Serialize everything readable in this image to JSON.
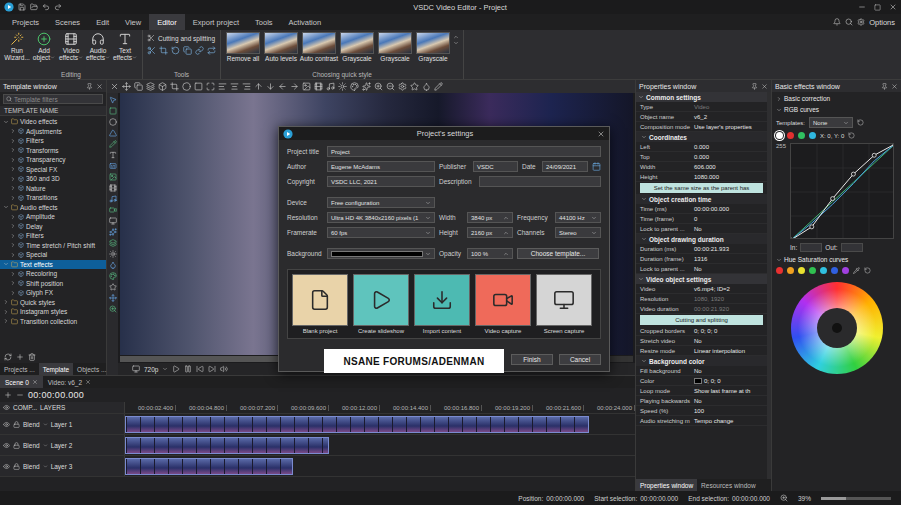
{
  "window": {
    "title": "VSDC Video Editor - Project"
  },
  "menu": {
    "tabs": [
      {
        "label": "Projects",
        "selected": false
      },
      {
        "label": "Scenes",
        "selected": false
      },
      {
        "label": "Edit",
        "selected": false
      },
      {
        "label": "View",
        "selected": false
      },
      {
        "label": "Editor",
        "selected": true
      },
      {
        "label": "Export project",
        "selected": false
      },
      {
        "label": "Tools",
        "selected": false
      },
      {
        "label": "Activation",
        "selected": false
      }
    ],
    "options": "Options"
  },
  "ribbon": {
    "editing": {
      "label": "Editing",
      "buttons": [
        {
          "label": "Run Wizard...",
          "dropdown": false
        },
        {
          "label": "Add object",
          "dropdown": true
        },
        {
          "label": "Video effects",
          "dropdown": true
        },
        {
          "label": "Audio effects",
          "dropdown": true
        },
        {
          "label": "Text effects",
          "dropdown": true
        }
      ]
    },
    "tools": {
      "label": "Tools",
      "button": "Cutting and splitting"
    },
    "quick_style": {
      "label": "Choosing quick style",
      "items": [
        {
          "label": "Remove all"
        },
        {
          "label": "Auto levels"
        },
        {
          "label": "Auto contrast"
        },
        {
          "label": "Grayscale"
        },
        {
          "label": "Grayscale"
        },
        {
          "label": "Grayscale"
        }
      ]
    }
  },
  "template_window": {
    "title": "Template window",
    "search": {
      "placeholder": "Template filters"
    },
    "column": "TEMPLATE NAME",
    "items": [
      {
        "label": "Video effects",
        "depth": 0,
        "expanded": true,
        "selected": false
      },
      {
        "label": "Adjustments",
        "depth": 1,
        "expanded": false,
        "selected": false
      },
      {
        "label": "Filters",
        "depth": 1,
        "expanded": false,
        "selected": false
      },
      {
        "label": "Transforms",
        "depth": 1,
        "expanded": false,
        "selected": false
      },
      {
        "label": "Transparency",
        "depth": 1,
        "expanded": false,
        "selected": false
      },
      {
        "label": "Special FX",
        "depth": 1,
        "expanded": false,
        "selected": false
      },
      {
        "label": "360 and 3D",
        "depth": 1,
        "expanded": false,
        "selected": false
      },
      {
        "label": "Nature",
        "depth": 1,
        "expanded": false,
        "selected": false
      },
      {
        "label": "Transitions",
        "depth": 1,
        "expanded": false,
        "selected": false
      },
      {
        "label": "Audio effects",
        "depth": 0,
        "expanded": true,
        "selected": false
      },
      {
        "label": "Amplitude",
        "depth": 1,
        "expanded": false,
        "selected": false
      },
      {
        "label": "Delay",
        "depth": 1,
        "expanded": false,
        "selected": false
      },
      {
        "label": "Filters",
        "depth": 1,
        "expanded": false,
        "selected": false
      },
      {
        "label": "Time stretch / Pitch shift",
        "depth": 1,
        "expanded": false,
        "selected": false
      },
      {
        "label": "Special",
        "depth": 1,
        "expanded": false,
        "selected": false
      },
      {
        "label": "Text effects",
        "depth": 0,
        "expanded": true,
        "selected": true
      },
      {
        "label": "Recoloring",
        "depth": 1,
        "expanded": false,
        "selected": false
      },
      {
        "label": "Shift position",
        "depth": 1,
        "expanded": false,
        "selected": false
      },
      {
        "label": "Glyph FX",
        "depth": 1,
        "expanded": false,
        "selected": false
      },
      {
        "label": "Quick styles",
        "depth": 0,
        "expanded": false,
        "selected": false
      },
      {
        "label": "Instagram styles",
        "depth": 0,
        "expanded": false,
        "selected": false
      },
      {
        "label": "Transition collection",
        "depth": 0,
        "expanded": false,
        "selected": false
      }
    ],
    "tabs": [
      {
        "label": "Projects ...",
        "selected": false
      },
      {
        "label": "Template",
        "selected": true
      },
      {
        "label": "Objects ...",
        "selected": false
      }
    ]
  },
  "preview": {
    "quality": "720p"
  },
  "dialog": {
    "title": "Project's settings",
    "project_title": {
      "label": "Project title",
      "value": "Project"
    },
    "author": {
      "label": "Author",
      "value": "Eugene McAdams"
    },
    "publisher": {
      "label": "Publisher",
      "value": "VSDC"
    },
    "date": {
      "label": "Date",
      "value": "24/09/2021"
    },
    "copyright": {
      "label": "Copyright",
      "value": "VSDC LLC, 2021"
    },
    "description": {
      "label": "Description",
      "value": ""
    },
    "device": {
      "label": "Device",
      "value": "Free configuration"
    },
    "resolution": {
      "label": "Resolution",
      "value": "Ultra HD 4K 3840x2160 pixels (1"
    },
    "width": {
      "label": "Width",
      "value": "3840 px"
    },
    "frequency": {
      "label": "Frequency",
      "value": "44100 Hz"
    },
    "framerate": {
      "label": "Framerate",
      "value": "60 fps"
    },
    "height": {
      "label": "Height",
      "value": "2160 px"
    },
    "channels": {
      "label": "Channels",
      "value": "Stereo"
    },
    "background": {
      "label": "Background",
      "swatch": "#000000"
    },
    "opacity": {
      "label": "Opacity",
      "value": "100 %"
    },
    "choose_template": "Choose template...",
    "templates": [
      {
        "label": "Blank project",
        "color": "#e9d3a9"
      },
      {
        "label": "Create slideshow",
        "color": "#5fc4bd"
      },
      {
        "label": "Import content",
        "color": "#4dbab2"
      },
      {
        "label": "Video capture",
        "color": "#ef6a5a"
      },
      {
        "label": "Screen capture",
        "color": "#d5d5d5"
      }
    ],
    "buttons": [
      "Finish",
      "Cancel"
    ]
  },
  "watermark": "NSANE FORUMS/ADENMAN",
  "timeline": {
    "tabs": [
      {
        "label": "Scene 0",
        "selected": true
      },
      {
        "label": "Video: v6_2",
        "selected": false
      }
    ],
    "time": "00:00:00.000",
    "comp": "COMP...",
    "layers_label": "LAYERS",
    "ticks": [
      "00:00:02.400",
      "00:00:04.800",
      "00:00:07.200",
      "00:00:09.600",
      "00:00:12.000",
      "00:00:14.400",
      "00:00:16.800",
      "00:00:19.200",
      "00:00:21.600",
      "00:00:24.000"
    ],
    "layers": [
      {
        "blend": "Blend",
        "name": "Layer 1",
        "level": 0.91
      },
      {
        "blend": "Blend",
        "name": "Layer 2",
        "level": 0.4
      },
      {
        "blend": "Blend",
        "name": "Layer 3",
        "level": 0.33
      }
    ]
  },
  "properties": {
    "title": "Properties window",
    "rows": [
      {
        "kind": "section",
        "label": "Common settings"
      },
      {
        "kind": "field",
        "label": "Type",
        "value": "Video",
        "disabled": true
      },
      {
        "kind": "field",
        "label": "Object name",
        "value": "v6_2",
        "disabled": false
      },
      {
        "kind": "field",
        "label": "Composition mode",
        "value": "Use layer's properties",
        "disabled": false
      },
      {
        "kind": "subsection",
        "label": "Coordinates"
      },
      {
        "kind": "field",
        "label": "Left",
        "value": "0.000",
        "disabled": false
      },
      {
        "kind": "field",
        "label": "Top",
        "value": "0.000",
        "disabled": false
      },
      {
        "kind": "field",
        "label": "Width",
        "value": "606.000",
        "disabled": false
      },
      {
        "kind": "field",
        "label": "Height",
        "value": "1080.000",
        "disabled": false
      },
      {
        "kind": "button",
        "label": "Set the same size as the parent has"
      },
      {
        "kind": "subsection",
        "label": "Object creation time"
      },
      {
        "kind": "field",
        "label": "Time (ms)",
        "value": "00:00:00.000",
        "disabled": false
      },
      {
        "kind": "field",
        "label": "Time (frame)",
        "value": "0",
        "disabled": false
      },
      {
        "kind": "field",
        "label": "Lock to parent ...",
        "value": "No",
        "disabled": false
      },
      {
        "kind": "subsection",
        "label": "Object drawing duration"
      },
      {
        "kind": "field",
        "label": "Duration (ms)",
        "value": "00:00:21.933",
        "disabled": false
      },
      {
        "kind": "field",
        "label": "Duration (frame)",
        "value": "1316",
        "disabled": false
      },
      {
        "kind": "field",
        "label": "Lock to parent ...",
        "value": "No",
        "disabled": false
      },
      {
        "kind": "section",
        "label": "Video object settings"
      },
      {
        "kind": "field",
        "label": "Video",
        "value": "v6.mp4; ID=2",
        "disabled": false
      },
      {
        "kind": "field",
        "label": "Resolution",
        "value": "1080, 1920",
        "disabled": true
      },
      {
        "kind": "field",
        "label": "Video duration",
        "value": "00:00:21.920",
        "disabled": true
      },
      {
        "kind": "button",
        "label": "Cutting and splitting"
      },
      {
        "kind": "field",
        "label": "Cropped borders",
        "value": "0; 0; 0; 0",
        "disabled": false
      },
      {
        "kind": "field",
        "label": "Stretch video",
        "value": "No",
        "disabled": false
      },
      {
        "kind": "field",
        "label": "Resize mode",
        "value": "Linear interpolation",
        "disabled": false
      },
      {
        "kind": "subsection",
        "label": "Background color"
      },
      {
        "kind": "field",
        "label": "Fill background",
        "value": "No",
        "disabled": false
      },
      {
        "kind": "field",
        "label": "Color",
        "value": "0; 0; 0",
        "swatch": "#000000",
        "disabled": false
      },
      {
        "kind": "field",
        "label": "Loop mode",
        "value": "Show last frame at th",
        "disabled": false
      },
      {
        "kind": "field",
        "label": "Playing backwards",
        "value": "No",
        "disabled": false
      },
      {
        "kind": "field",
        "label": "Speed (%)",
        "value": "100",
        "disabled": false
      },
      {
        "kind": "field",
        "label": "Audio stretching m",
        "value": "Tempo change",
        "disabled": false
      }
    ],
    "tabs": [
      {
        "label": "Properties window",
        "selected": true
      },
      {
        "label": "Resources window",
        "selected": false
      }
    ]
  },
  "effects": {
    "title": "Basic effects window",
    "section": "Basic correction",
    "rgb": {
      "title": "RGB curves",
      "templates_label": "Templates:",
      "template": "None",
      "channels": [
        {
          "color": "#ffffff",
          "selected": true
        },
        {
          "color": "#e03030",
          "selected": false
        },
        {
          "color": "#30c060",
          "selected": false
        },
        {
          "color": "#30b8e0",
          "selected": false
        }
      ],
      "coords": "X: 0, Y: 0",
      "axis_max": "255",
      "in_label": "In:",
      "out_label": "Out:",
      "series": [
        {
          "name": "Green",
          "color": "#3cb371",
          "markers": false,
          "values": [
            0,
            51,
            102,
            153,
            204,
            255
          ]
        },
        {
          "name": "Blue",
          "color": "#4aa3df",
          "markers": false,
          "values": [
            0,
            45,
            95,
            150,
            210,
            255
          ]
        },
        {
          "name": "Master",
          "color": "#e8e8e8",
          "markers": true,
          "values": [
            0,
            35,
            110,
            175,
            225,
            255
          ]
        }
      ]
    },
    "hue": {
      "title": "Hue Saturation curves",
      "colors": [
        {
          "color": "#e83030"
        },
        {
          "color": "#f0a020"
        },
        {
          "color": "#e8e030"
        },
        {
          "color": "#30c050"
        },
        {
          "color": "#30c0e0"
        },
        {
          "color": "#3060e0"
        },
        {
          "color": "#a040e0"
        }
      ]
    }
  },
  "status_bar": {
    "items": [
      {
        "label": "Position:",
        "value": "00:00:00.000"
      },
      {
        "label": "Start selection:",
        "value": "00:00:00.000"
      },
      {
        "label": "End selection:",
        "value": "00:00:00.000"
      }
    ],
    "zoom": {
      "value": "39%",
      "level": 0.35
    }
  }
}
